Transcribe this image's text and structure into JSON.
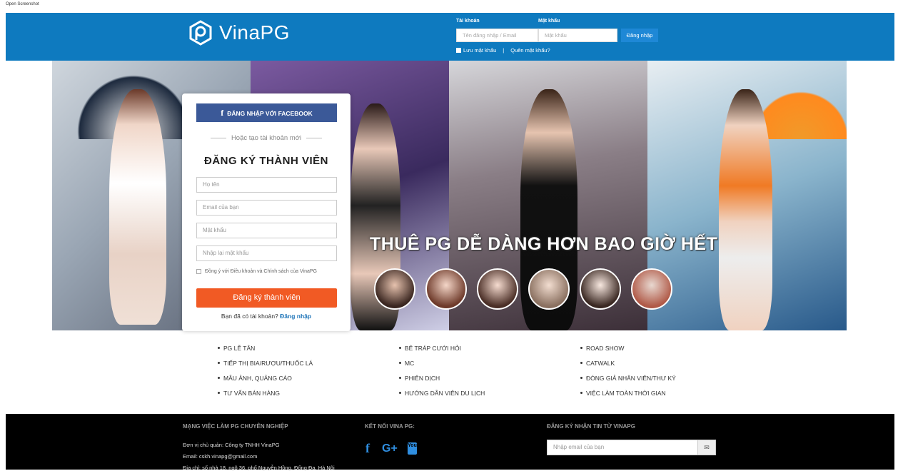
{
  "page_caption": "Open Screenshot",
  "header": {
    "logo_text": "VinaPG",
    "username_label": "Tài khoản",
    "username_placeholder": "Tên đăng nhập / Email",
    "password_label": "Mật khẩu",
    "password_placeholder": "Mật khẩu",
    "login_button": "Đăng nhập",
    "remember_label": "Lưu mật khẩu",
    "separator": "|",
    "forgot_link": "Quên mật khẩu?"
  },
  "hero": {
    "tagline": "THUÊ PG DỄ DÀNG HƠN BAO GIỜ HẾT",
    "avatar_count": 6
  },
  "register": {
    "facebook_button": "ĐĂNG NHẬP VỚI FACEBOOK",
    "facebook_glyph": "f",
    "or_text": "Hoặc tạo tài khoản mới",
    "title": "ĐĂNG KÝ THÀNH VIÊN",
    "fields": [
      {
        "placeholder": "Họ tên"
      },
      {
        "placeholder": "Email của bạn"
      },
      {
        "placeholder": "Mật khẩu"
      },
      {
        "placeholder": "Nhập lại mật khẩu"
      }
    ],
    "agree_text": "Đồng ý với Điều khoản và Chính sách của VinaPG",
    "submit_button": "Đăng ký thành viên",
    "already_text": "Bạn đã có tài khoản?",
    "already_link": "Đăng nhập"
  },
  "services": [
    "PG LỄ TÂN",
    "BÊ TRÁP CƯỚI HỎI",
    "ROAD SHOW",
    "TIẾP THỊ BIA/RƯỢU/THUỐC LÁ",
    "MC",
    "CATWALK",
    "MẪU ẢNH, QUẢNG CÁO",
    "PHIÊN DỊCH",
    "ĐÓNG GIẢ NHÂN VIÊN/THƯ KÝ",
    "TƯ VẤN BÁN HÀNG",
    "HƯỚNG DẪN VIÊN DU LỊCH",
    "VIỆC LÀM TOÀN THỜI GIAN"
  ],
  "footer": {
    "col1_title": "MẠNG VIỆC LÀM PG CHUYÊN NGHIỆP",
    "owner": "Đơn vị chủ quản: Công ty TNHH VinaPG",
    "email": "Email: cskh.vinapg@gmail.com",
    "address": "Địa chỉ: số nhà 18, ngõ 36, phố Nguyễn Hồng, Đống Đa, Hà Nội",
    "col2_title": "KẾT NỐI VINA PG:",
    "social_facebook": "f",
    "social_google": "G+",
    "social_youtube": "You",
    "col3_title": "ĐĂNG KÝ NHẬN TIN TỪ VINAPG",
    "newsletter_placeholder": "Nhập email của bạn",
    "newsletter_icon": "✉"
  },
  "colors": {
    "header_blue": "#0e7abf",
    "facebook": "#3b5998",
    "submit_orange": "#f15a24",
    "link_blue": "#1e74b8"
  }
}
